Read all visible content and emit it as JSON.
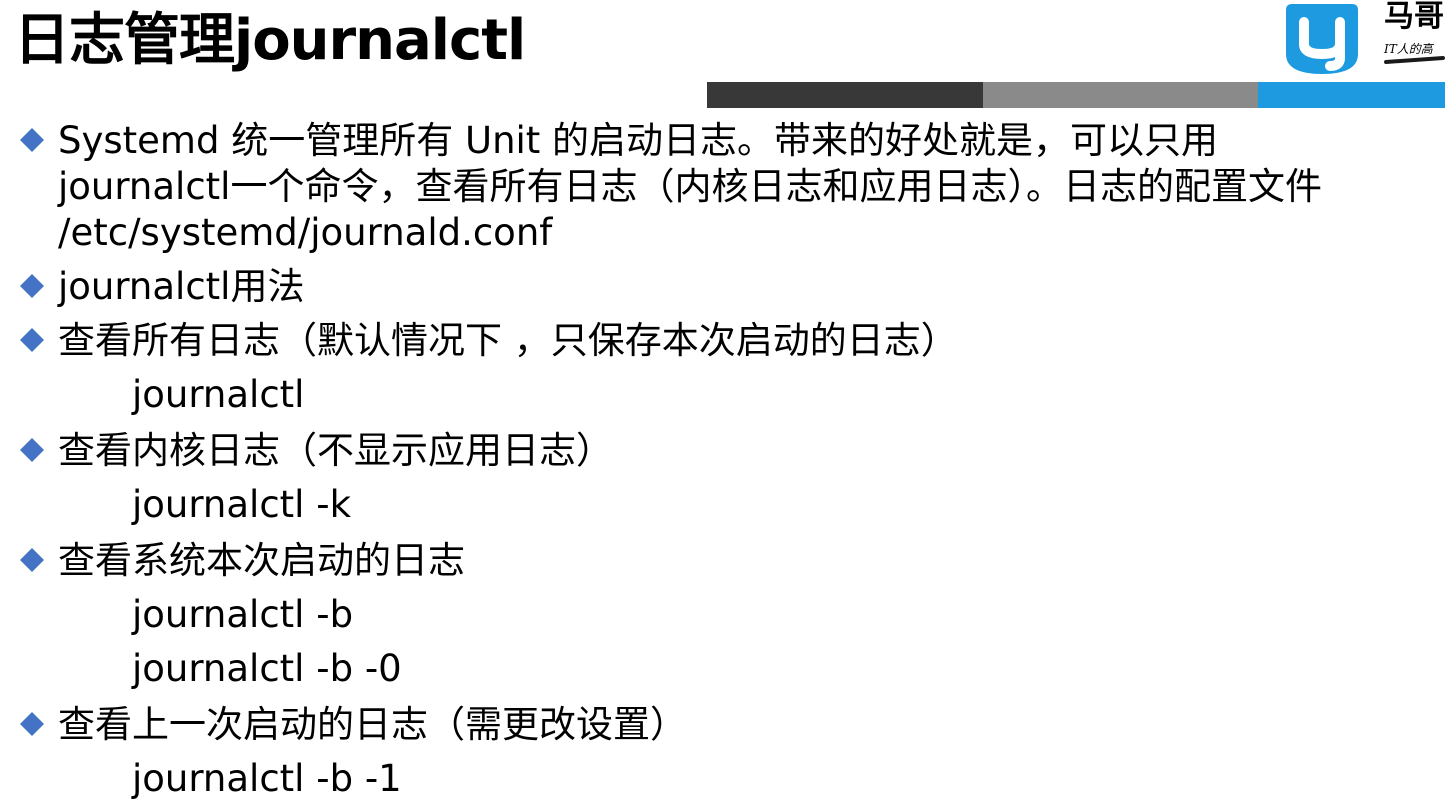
{
  "slide": {
    "title": "日志管理journalctl",
    "header_bar_colors": [
      "#383838",
      "#8a8a8a",
      "#1e9be0"
    ]
  },
  "logo": {
    "icon": "magedu-g-logo-icon",
    "name": "马哥",
    "slogan": "IT人的高",
    "brand_color": "#1e9be0"
  },
  "bullet_style": {
    "icon": "diamond-bullet-icon",
    "color": "#4472c4"
  },
  "content": {
    "intro": {
      "lines": [
        "Systemd 统一管理所有 Unit 的启动日志。带来的好处就是，可以只用",
        "journalctl一个命令，查看所有日志（内核日志和应用日志）。日志的配置文件",
        "/etc/systemd/journald.conf"
      ]
    },
    "usage": "journalctl用法",
    "items": [
      {
        "desc": "查看所有日志（默认情况下 ，只保存本次启动的日志）",
        "commands": [
          "journalctl"
        ]
      },
      {
        "desc": "查看内核日志（不显示应用日志）",
        "commands": [
          "journalctl -k"
        ]
      },
      {
        "desc": "查看系统本次启动的日志",
        "commands": [
          "journalctl -b",
          "journalctl -b -0"
        ]
      },
      {
        "desc": " 查看上一次启动的日志（需更改设置）",
        "commands": [
          "journalctl -b -1"
        ]
      }
    ]
  }
}
